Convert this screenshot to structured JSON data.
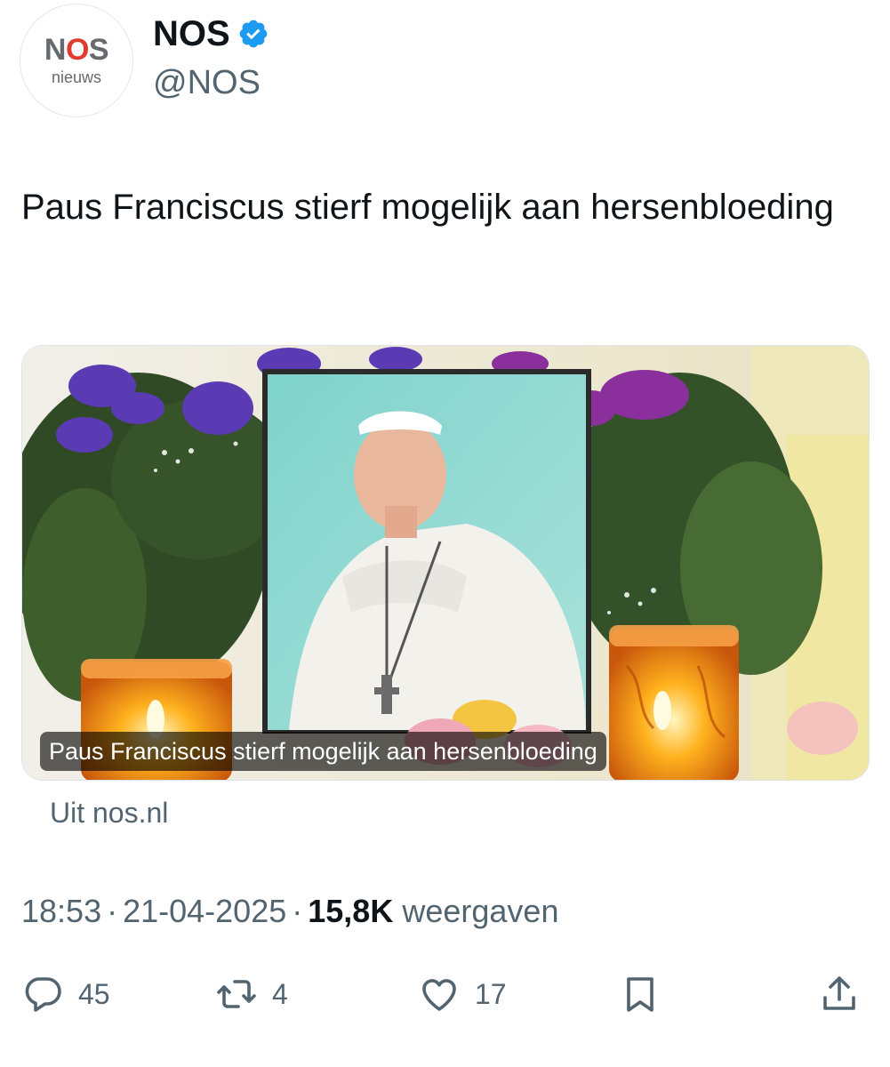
{
  "account": {
    "logo_text_main": "NOS",
    "logo_text_sub": "nieuws",
    "name": "NOS",
    "handle": "@NOS",
    "verified_icon": "verified-badge-icon",
    "verified_color": "#1d9bf0"
  },
  "tweet": {
    "text": "Paus Franciscus stierf mogelijk aan hersenbloeding"
  },
  "link_card": {
    "image_title": "Paus Franciscus stierf mogelijk aan hersenbloeding",
    "source": "Uit nos.nl"
  },
  "meta": {
    "time": "18:53",
    "date": "21-04-2025",
    "views_count": "15,8K",
    "views_label": "weergaven",
    "separator": "·"
  },
  "actions": {
    "replies": "45",
    "retweets": "4",
    "likes": "17",
    "icons": [
      "reply-icon",
      "retweet-icon",
      "like-icon",
      "bookmark-icon",
      "share-icon"
    ],
    "icon_color": "#536471"
  }
}
